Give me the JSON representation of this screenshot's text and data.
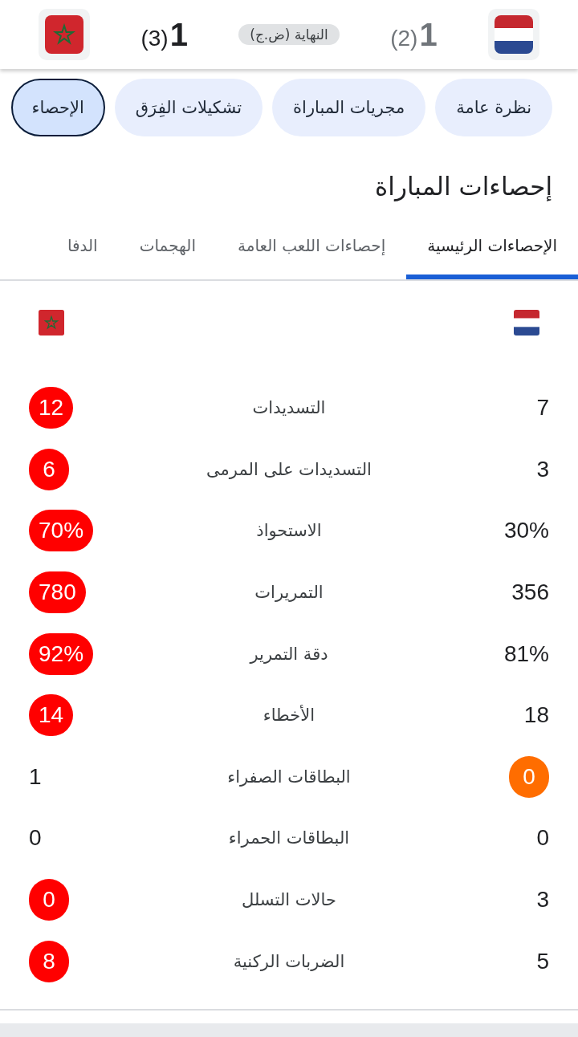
{
  "header": {
    "home": {
      "score": "1",
      "penalties": "(2)",
      "winner": false,
      "color": "#ff6d00"
    },
    "status": "النهاية (ض.ج)",
    "away": {
      "score": "1",
      "penalties": "(3)",
      "winner": true,
      "color": "#ff0000"
    }
  },
  "chips": [
    {
      "label": "نظرة عامة",
      "selected": false
    },
    {
      "label": "مجريات المباراة",
      "selected": false
    },
    {
      "label": "تشكيلات الفِرَق",
      "selected": false
    },
    {
      "label": "الإحصاء",
      "selected": true
    }
  ],
  "title": "إحصاءات المباراة",
  "tabs": [
    {
      "label": "الإحصاءات الرئيسية",
      "selected": true
    },
    {
      "label": "إحصاءات اللعب العامة",
      "selected": false
    },
    {
      "label": "الهجمات",
      "selected": false
    },
    {
      "label": "الدفا",
      "selected": false
    }
  ],
  "stats": [
    {
      "label": "التسديدات",
      "home": "7",
      "away": "12",
      "home_leads": false,
      "away_leads": true
    },
    {
      "label": "التسديدات على المرمى",
      "home": "3",
      "away": "6",
      "home_leads": false,
      "away_leads": true
    },
    {
      "label": "الاستحواذ",
      "home": "30%",
      "away": "70%",
      "home_leads": false,
      "away_leads": true
    },
    {
      "label": "التمريرات",
      "home": "356",
      "away": "780",
      "home_leads": false,
      "away_leads": true
    },
    {
      "label": "دقة التمرير",
      "home": "81%",
      "away": "92%",
      "home_leads": false,
      "away_leads": true
    },
    {
      "label": "الأخطاء",
      "home": "18",
      "away": "14",
      "home_leads": false,
      "away_leads": true
    },
    {
      "label": "البطاقات الصفراء",
      "home": "0",
      "away": "1",
      "home_leads": true,
      "away_leads": false
    },
    {
      "label": "البطاقات الحمراء",
      "home": "0",
      "away": "0",
      "home_leads": false,
      "away_leads": false
    },
    {
      "label": "حالات التسلل",
      "home": "3",
      "away": "0",
      "home_leads": false,
      "away_leads": true
    },
    {
      "label": "الضربات الركنية",
      "home": "5",
      "away": "8",
      "home_leads": false,
      "away_leads": true
    }
  ]
}
